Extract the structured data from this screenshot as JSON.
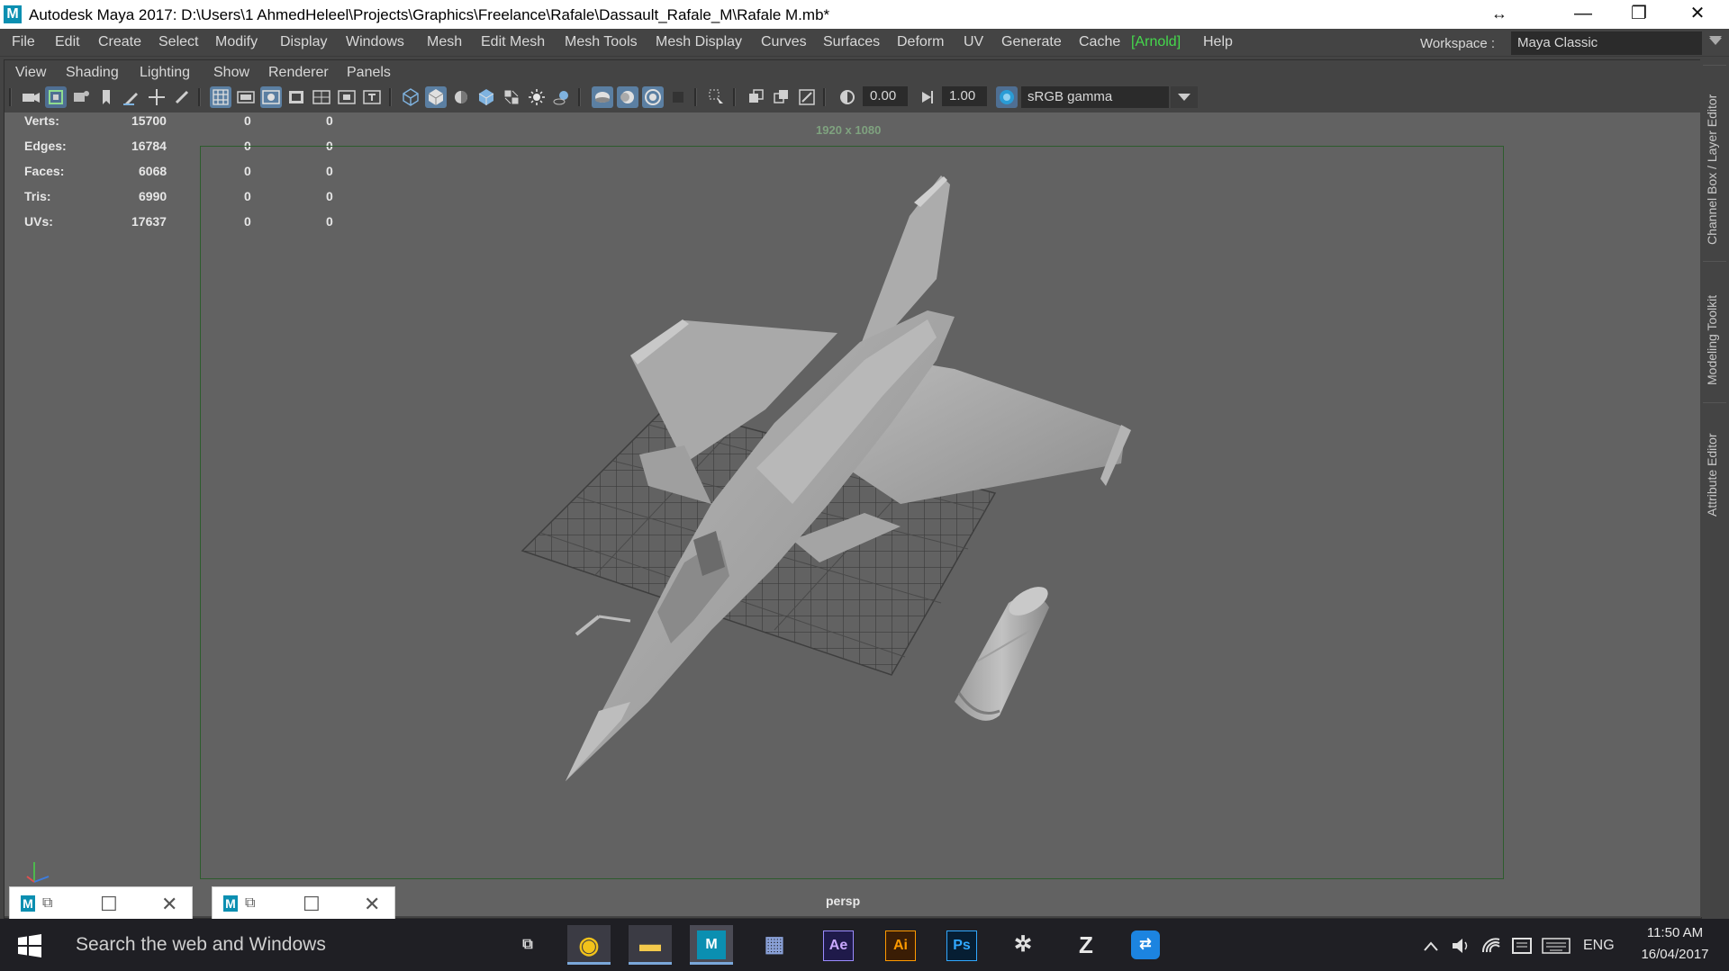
{
  "window": {
    "title": "Autodesk Maya 2017: D:\\Users\\1 AhmedHeleel\\Projects\\Graphics\\Freelance\\Rafale\\Dassault_Rafale_M\\Rafale M.mb*",
    "logo": "M",
    "controls": {
      "resize": "↔",
      "minimize": "—",
      "restore": "❐",
      "close": "✕"
    }
  },
  "menubar": {
    "items": [
      "File",
      "Edit",
      "Create",
      "Select",
      "Modify",
      "Display",
      "Windows",
      "Mesh",
      "Edit Mesh",
      "Mesh Tools",
      "Mesh Display",
      "Curves",
      "Surfaces",
      "Deform",
      "UV",
      "Generate",
      "Cache",
      "[Arnold]",
      "Help"
    ],
    "workspace_label": "Workspace :",
    "workspace_value": "Maya Classic"
  },
  "panel": {
    "menu": [
      "View",
      "Shading",
      "Lighting",
      "Show",
      "Renderer",
      "Panels"
    ],
    "exposure": "0.00",
    "gamma": "1.00",
    "color_space": "sRGB gamma"
  },
  "hud": {
    "rows": [
      {
        "label": "Verts:",
        "v1": "15700",
        "v2": "0",
        "v3": "0"
      },
      {
        "label": "Edges:",
        "v1": "16784",
        "v2": "0",
        "v3": "0"
      },
      {
        "label": "Faces:",
        "v1": "6068",
        "v2": "0",
        "v3": "0"
      },
      {
        "label": "Tris:",
        "v1": "6990",
        "v2": "0",
        "v3": "0"
      },
      {
        "label": "UVs:",
        "v1": "17637",
        "v2": "0",
        "v3": "0"
      }
    ],
    "resolution": "1920 x 1080",
    "camera": "persp"
  },
  "side_tabs": [
    "Channel Box / Layer Editor",
    "Modeling Toolkit",
    "Attribute Editor"
  ],
  "minimized": [
    {
      "logo": "M",
      "restore": "⧉",
      "maximize": "☐",
      "close": "✕"
    },
    {
      "logo": "M",
      "restore": "⧉",
      "maximize": "☐",
      "close": "✕"
    }
  ],
  "taskbar": {
    "search_placeholder": "Search the web and Windows",
    "apps": [
      {
        "name": "task-view",
        "glyph": "⧉"
      },
      {
        "name": "chrome",
        "glyph": "◉"
      },
      {
        "name": "file-explorer",
        "glyph": "▬"
      },
      {
        "name": "maya",
        "glyph": "M"
      },
      {
        "name": "media-app",
        "glyph": "▦"
      },
      {
        "name": "after-effects",
        "glyph": "Ae"
      },
      {
        "name": "illustrator",
        "glyph": "Ai"
      },
      {
        "name": "photoshop",
        "glyph": "Ps"
      },
      {
        "name": "app-gear",
        "glyph": "✲"
      },
      {
        "name": "zbrush",
        "glyph": "Z"
      },
      {
        "name": "teamviewer",
        "glyph": "⇄"
      }
    ],
    "language": "ENG",
    "time": "11:50 AM",
    "date": "16/04/2017"
  }
}
